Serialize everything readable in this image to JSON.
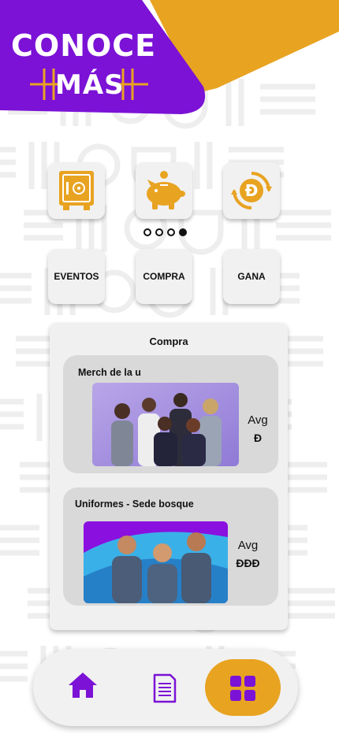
{
  "header": {
    "title_line1": "CONOCE",
    "title_line2": "MÁS"
  },
  "colors": {
    "purple": "#7b12d6",
    "orange": "#e8a321",
    "card_bg": "#f1f1f1",
    "pattern": "#eeeeee"
  },
  "carousel": {
    "items": [
      {
        "icon": "safe-icon"
      },
      {
        "icon": "piggy-bank-icon"
      },
      {
        "icon": "coin-exchange-icon"
      }
    ],
    "page_count": 4,
    "active_page": 4
  },
  "tabs": [
    {
      "label": "EVENTOS"
    },
    {
      "label": "COMPRA"
    },
    {
      "label": "GANA"
    }
  ],
  "panel": {
    "title": "Compra",
    "products": [
      {
        "name": "Merch de la u",
        "price_label": "Avg",
        "price_value": "Đ"
      },
      {
        "name": "Uniformes - Sede bosque",
        "price_label": "Avg",
        "price_value": "ĐĐĐ"
      }
    ]
  },
  "bottom_nav": {
    "items": [
      {
        "icon": "home-icon"
      },
      {
        "icon": "document-icon"
      },
      {
        "icon": "grid-icon",
        "active": true
      }
    ]
  }
}
